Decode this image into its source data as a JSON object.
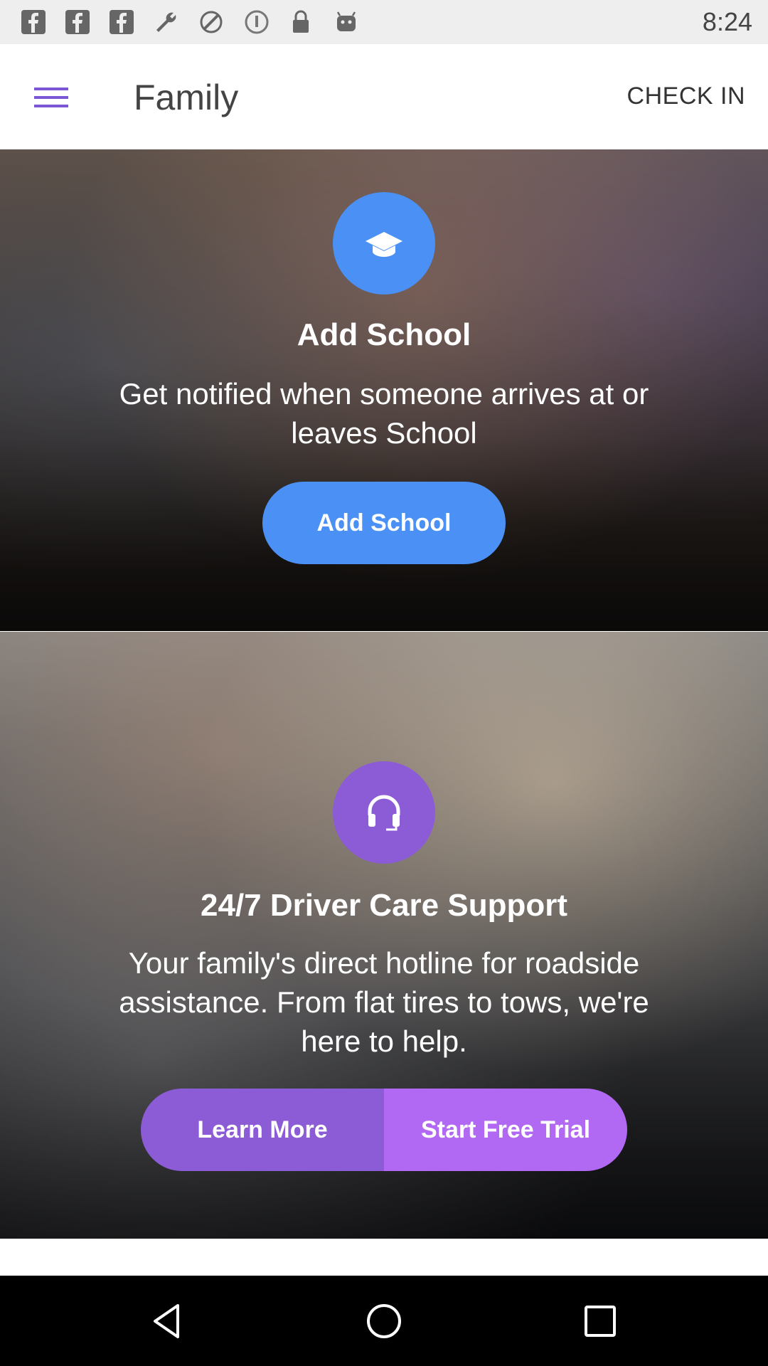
{
  "status_bar": {
    "time": "8:24",
    "icons": [
      "facebook-icon",
      "facebook-icon",
      "facebook-icon",
      "wrench-icon",
      "fake-gps-icon",
      "info-icon",
      "lock-icon",
      "android-icon"
    ]
  },
  "app_bar": {
    "title": "Family",
    "check_in_label": "CHECK IN"
  },
  "school_card": {
    "icon": "graduation-cap-icon",
    "icon_color": "#4a90f5",
    "title": "Add School",
    "description": "Get notified when someone arrives at or leaves School",
    "button_label": "Add School",
    "button_color": "#4a90f5"
  },
  "support_card": {
    "icon": "headphones-icon",
    "icon_color": "#8b5cd6",
    "title": "24/7 Driver Care Support",
    "description": "Your family's direct hotline for roadside assistance. From flat tires to tows, we're here to help.",
    "learn_more_label": "Learn More",
    "learn_more_color": "#8b5cd6",
    "trial_label": "Start Free Trial",
    "trial_color": "#b168f2"
  },
  "nav_bar": {
    "buttons": [
      "back-icon",
      "home-icon",
      "recents-icon"
    ]
  }
}
